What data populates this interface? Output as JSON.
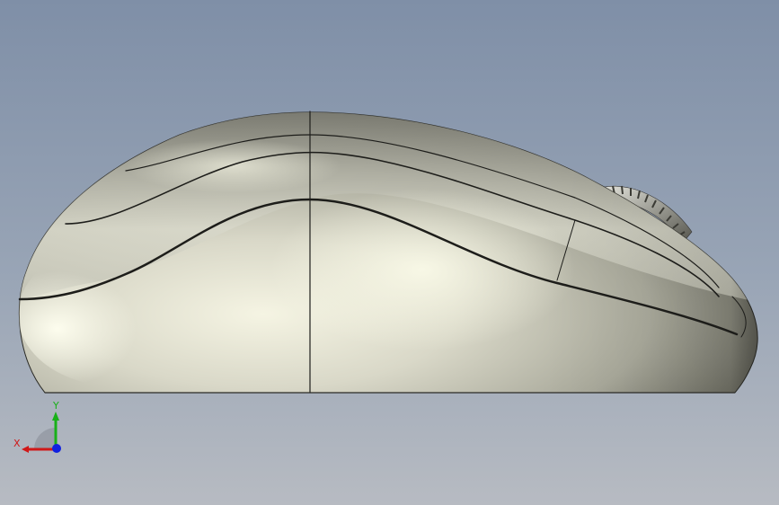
{
  "triad": {
    "x_label": "X",
    "y_label": "Y",
    "x_color": "#d01818",
    "y_color": "#18b018",
    "z_color": "#1020e0"
  },
  "colors": {
    "background_top": "#7f8fa7",
    "background_bottom": "#b7bbc2",
    "body_highlight": "#f8f7e8",
    "body_shadow": "#3a3a33"
  }
}
